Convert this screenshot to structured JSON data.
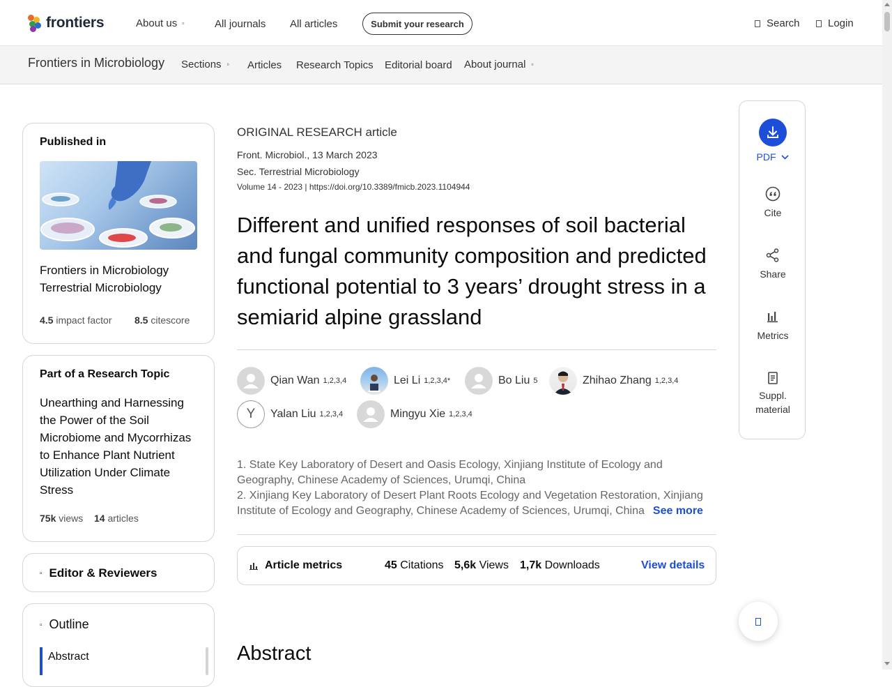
{
  "header": {
    "logo_text": "frontiers",
    "nav": [
      {
        "label": "About us",
        "has_caret": true
      },
      {
        "label": "All journals",
        "has_caret": false
      },
      {
        "label": "All articles",
        "has_caret": false
      }
    ],
    "submit_label": "Submit your research",
    "search_label": "Search",
    "login_label": "Login"
  },
  "subheader": {
    "journal_name": "Frontiers in Microbiology",
    "nav": [
      {
        "label": "Sections",
        "has_caret": true
      },
      {
        "label": "Articles",
        "has_caret": false
      },
      {
        "label": "Research Topics",
        "has_caret": false
      },
      {
        "label": "Editorial board",
        "has_caret": false
      },
      {
        "label": "About journal",
        "has_caret": true
      }
    ]
  },
  "published_in": {
    "title": "Published in",
    "journal_line1": "Frontiers in Microbiology",
    "journal_line2": "Terrestrial Microbiology",
    "impact_value": "4.5",
    "impact_label": "impact factor",
    "citescore_value": "8.5",
    "citescore_label": "citescore"
  },
  "research_topic": {
    "title": "Part of a Research Topic",
    "topic": "Unearthing and Harnessing the Power of the Soil Microbiome and Mycorrhizas to Enhance Plant Nutrient Utilization Under Climate Stress",
    "views_value": "75k",
    "views_label": "views",
    "articles_value": "14",
    "articles_label": "articles"
  },
  "editors": {
    "label": "Editor & Reviewers"
  },
  "outline": {
    "title": "Outline",
    "items": [
      "Abstract"
    ]
  },
  "article": {
    "type": "ORIGINAL RESEARCH article",
    "journal_date": "Front. Microbiol., 13 March 2023",
    "section": "Sec. Terrestrial Microbiology",
    "volume_doi": "Volume 14 - 2023 | https://doi.org/10.3389/fmicb.2023.1104944",
    "title": "Different and unified responses of soil bacterial and fungal community composition and predicted functional potential to 3 years’ drought stress in a semiarid alpine grassland",
    "authors": [
      {
        "name": "Qian Wan",
        "sup": "1,2,3,4",
        "avatar": "placeholder"
      },
      {
        "name": "Lei Li",
        "sup": "1,2,3,4*",
        "avatar": "photo"
      },
      {
        "name": "Bo Liu",
        "sup": "5",
        "avatar": "placeholder"
      },
      {
        "name": "Zhihao Zhang",
        "sup": "1,2,3,4",
        "avatar": "photo"
      },
      {
        "name": "Yalan Liu",
        "sup": "1,2,3,4",
        "avatar": "letter",
        "letter": "Y"
      },
      {
        "name": "Mingyu Xie",
        "sup": "1,2,3,4",
        "avatar": "placeholder"
      }
    ],
    "affiliations": [
      "1. State Key Laboratory of Desert and Oasis Ecology, Xinjiang Institute of Ecology and Geography, Chinese Academy of Sciences, Urumqi, China",
      "2. Xinjiang Key Laboratory of Desert Plant Roots Ecology and Vegetation Restoration, Xinjiang Institute of Ecology and Geography, Chinese Academy of Sciences, Urumqi, China"
    ],
    "see_more": "See more",
    "metrics": {
      "label": "Article metrics",
      "citations_value": "45",
      "citations_label": "Citations",
      "views_value": "5,6k",
      "views_label": "Views",
      "downloads_value": "1,7k",
      "downloads_label": "Downloads",
      "view_details": "View details"
    },
    "abstract_heading": "Abstract"
  },
  "tools": {
    "pdf": "PDF",
    "cite": "Cite",
    "share": "Share",
    "metrics": "Metrics",
    "suppl_line1": "Suppl.",
    "suppl_line2": "material"
  },
  "colors": {
    "accent": "#1d4ed8",
    "text": "#0c0c0c",
    "muted": "#666666",
    "subbar_bg": "#f4f4f4",
    "border": "#d6d6d6"
  }
}
